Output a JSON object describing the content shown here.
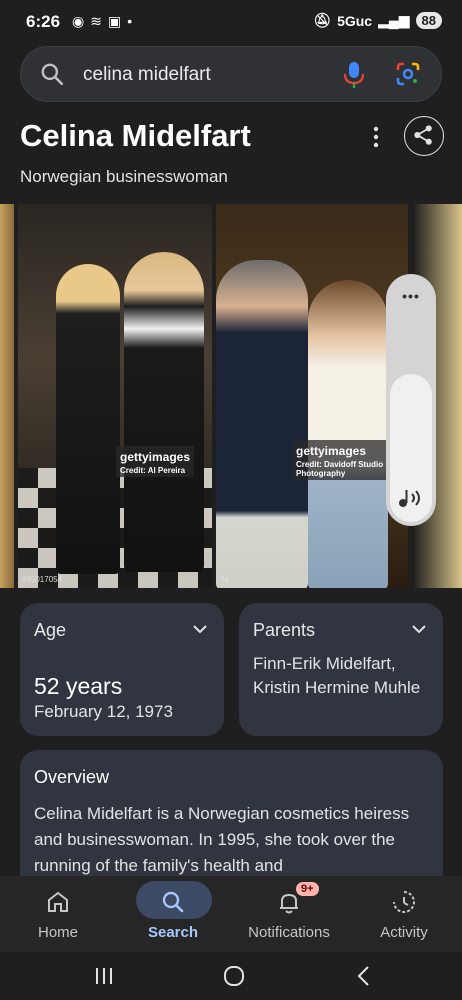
{
  "status_bar": {
    "time": "6:26",
    "left_icons": [
      "chrome-icon",
      "signal-waves-icon",
      "screenshot-icon",
      "dot-icon"
    ],
    "network": "5Guc",
    "battery": "88"
  },
  "search": {
    "query": "celina midelfart"
  },
  "knowledge_panel": {
    "title": "Celina Midelfart",
    "subtitle": "Norwegian businesswoman"
  },
  "gallery": {
    "photo1": {
      "watermark": "gettyimages",
      "credit": "Credit: Al Pereira",
      "photo_id": "645017054"
    },
    "photo2": {
      "watermark": "gettyimages",
      "credit": "Credit: Davidoff Studio Photography",
      "photo_id": "34"
    }
  },
  "cards": {
    "age": {
      "label": "Age",
      "value": "52 years",
      "date": "February 12, 1973"
    },
    "parents": {
      "label": "Parents",
      "value": "Finn-Erik Midelfart, Kristin Hermine Muhle"
    },
    "overview": {
      "label": "Overview",
      "text": "Celina Midelfart is a Norwegian cosmetics heiress and businesswoman. In 1995, she took over the running of the family's health and"
    }
  },
  "bottom_nav": {
    "items": [
      {
        "label": "Home",
        "icon": "home-icon"
      },
      {
        "label": "Search",
        "icon": "search-icon",
        "active": true
      },
      {
        "label": "Notifications",
        "icon": "bell-icon",
        "badge": "9+"
      },
      {
        "label": "Activity",
        "icon": "activity-icon"
      }
    ]
  },
  "colors": {
    "background": "#1f1f1f",
    "card": "#303540",
    "active": "#a8c7fa",
    "badge": "#ffb4ab"
  }
}
